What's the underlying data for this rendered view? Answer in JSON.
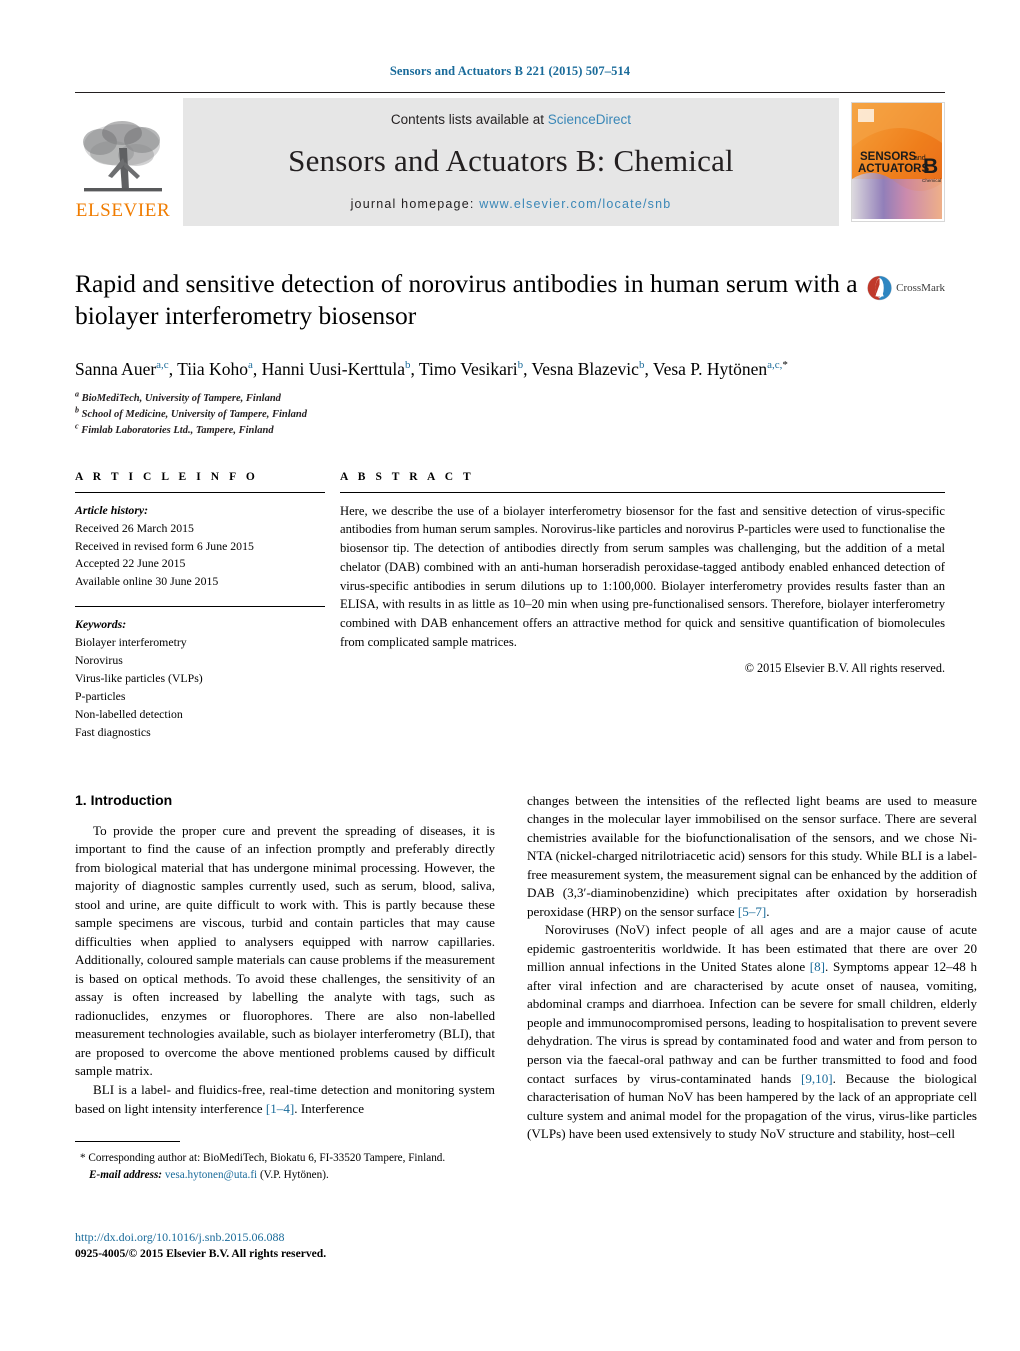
{
  "running_head": "Sensors and Actuators B 221 (2015) 507–514",
  "masthead": {
    "contents_prefix": "Contents lists available at",
    "sciencedirect": "ScienceDirect",
    "journal_title": "Sensors and Actuators B: Chemical",
    "homepage_label": "journal homepage:",
    "homepage_url": "www.elsevier.com/locate/snb",
    "publisher_name": "ELSEVIER",
    "publisher_color": "#f07c00",
    "link_color": "#3a87b7",
    "cover": {
      "line1": "SENSORS",
      "line1_small": "and",
      "line2": "ACTUATORS",
      "letter": "B",
      "letter_sub": "Chemical"
    }
  },
  "article": {
    "title": "Rapid and sensitive detection of norovirus antibodies in human serum with a biolayer interferometry biosensor",
    "crossmark_label": "CrossMark",
    "authors_html": "Sanna Auer<sup>a,c</sup>, Tiia Koho<sup>a</sup>, Hanni Uusi-Kerttula<sup>b</sup>, Timo Vesikari<sup>b</sup>, Vesna Blazevic<sup>b</sup>, Vesa P. Hytönen<sup>a,c,</sup><sup class=\"star\">*</sup>",
    "affiliations": [
      {
        "marker": "a",
        "text": "BioMediTech, University of Tampere, Finland"
      },
      {
        "marker": "b",
        "text": "School of Medicine, University of Tampere, Finland"
      },
      {
        "marker": "c",
        "text": "Fimlab Laboratories Ltd., Tampere, Finland"
      }
    ]
  },
  "article_info": {
    "heading": "A R T I C L E   I N F O",
    "history_label": "Article history:",
    "history": [
      "Received 26 March 2015",
      "Received in revised form 6 June 2015",
      "Accepted 22 June 2015",
      "Available online 30 June 2015"
    ],
    "keywords_label": "Keywords:",
    "keywords": [
      "Biolayer interferometry",
      "Norovirus",
      "Virus-like particles (VLPs)",
      "P-particles",
      "Non-labelled detection",
      "Fast diagnostics"
    ]
  },
  "abstract": {
    "heading": "A B S T R A C T",
    "text": "Here, we describe the use of a biolayer interferometry biosensor for the fast and sensitive detection of virus-specific antibodies from human serum samples. Norovirus-like particles and norovirus P-particles were used to functionalise the biosensor tip. The detection of antibodies directly from serum samples was challenging, but the addition of a metal chelator (DAB) combined with an anti-human horseradish peroxidase-tagged antibody enabled enhanced detection of virus-specific antibodies in serum dilutions up to 1:100,000. Biolayer interferometry provides results faster than an ELISA, with results in as little as 10–20 min when using pre-functionalised sensors. Therefore, biolayer interferometry combined with DAB enhancement offers an attractive method for quick and sensitive quantification of biomolecules from complicated sample matrices.",
    "copyright": "© 2015 Elsevier B.V. All rights reserved."
  },
  "introduction": {
    "number_title": "1.  Introduction",
    "left_paragraphs": [
      "To provide the proper cure and prevent the spreading of diseases, it is important to find the cause of an infection promptly and preferably directly from biological material that has undergone minimal processing. However, the majority of diagnostic samples currently used, such as serum, blood, saliva, stool and urine, are quite difficult to work with. This is partly because these sample specimens are viscous, turbid and contain particles that may cause difficulties when applied to analysers equipped with narrow capillaries. Additionally, coloured sample materials can cause problems if the measurement is based on optical methods. To avoid these challenges, the sensitivity of an assay is often increased by labelling the analyte with tags, such as radionuclides, enzymes or fluorophores. There are also non-labelled measurement technologies available, such as biolayer interferometry (BLI), that are proposed to overcome the above mentioned problems caused by difficult sample matrix."
    ],
    "left_last_paragraph_pre": "BLI is a label- and fluidics-free, real-time detection and monitoring system based on light intensity interference ",
    "left_last_paragraph_ref": "[1–4]",
    "left_last_paragraph_post": ". Interference",
    "right_para1_pre": "changes between the intensities of the reflected light beams are used to measure changes in the molecular layer immobilised on the sensor surface. There are several chemistries available for the biofunctionalisation of the sensors, and we chose Ni-NTA (nickel-charged nitrilotriacetic acid) sensors for this study. While BLI is a label-free measurement system, the measurement signal can be enhanced by the addition of DAB (3,3′-diaminobenzidine) which precipitates after oxidation by horseradish peroxidase (HRP) on the sensor surface ",
    "right_para1_ref": "[5–7]",
    "right_para1_post": ".",
    "right_para2_a": "Noroviruses (NoV) infect people of all ages and are a major cause of acute epidemic gastroenteritis worldwide. It has been estimated that there are over 20 million annual infections in the United States alone ",
    "right_para2_ref1": "[8]",
    "right_para2_b": ". Symptoms appear 12–48 h after viral infection and are characterised by acute onset of nausea, vomiting, abdominal cramps and diarrhoea. Infection can be severe for small children, elderly people and immunocompromised persons, leading to hospitalisation to prevent severe dehydration. The virus is spread by contaminated food and water and from person to person via the faecal-oral pathway and can be further transmitted to food and food contact surfaces by virus-contaminated hands ",
    "right_para2_ref2": "[9,10]",
    "right_para2_c": ". Because the biological characterisation of human NoV has been hampered by the lack of an appropriate cell culture system and animal model for the propagation of the virus, virus-like particles (VLPs) have been used extensively to study NoV structure and stability, host–cell"
  },
  "footnote": {
    "star": "*",
    "corresponding": "Corresponding author at: BioMediTech, Biokatu 6, FI-33520 Tampere, Finland.",
    "email_label": "E-mail address:",
    "email": "vesa.hytonen@uta.fi",
    "email_owner": "(V.P. Hytönen)."
  },
  "page_footer": {
    "doi": "http://dx.doi.org/10.1016/j.snb.2015.06.088",
    "issn_line": "0925-4005/© 2015 Elsevier B.V. All rights reserved."
  }
}
